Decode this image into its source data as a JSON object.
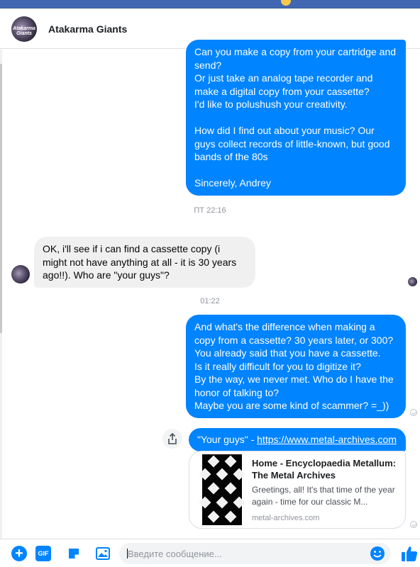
{
  "header": {
    "avatar_text": "Atakarma Giants",
    "title": "Atakarma Giants"
  },
  "messages": {
    "m1": {
      "line1": "Can you make a copy from your cartridge and send?",
      "line2": "Or just take an analog tape recorder and make a digital copy from your cassette?",
      "line3": "I'd like to polushush your creativity.",
      "line4": "How did I find out about your music? Our guys collect records of little-known, but good bands of the 80s",
      "line5": "Sincerely, Andrey"
    },
    "ts1": "ПТ 22:16",
    "incoming": "OK, i'll see if i can find a cassette copy (i might not have anything at all - it is 30 years ago!!). Who are \"your guys\"?",
    "ts2": "01:22",
    "m2": {
      "line1": "And what's the difference when making a copy from a cassette? 30 years later, or 300?",
      "line2": "You already said that you have a cassette.",
      "line3": "Is it really difficult for you to digitize it?",
      "line4": "By the way, we never met. Who do I have the honor of talking to?",
      "line5": "Maybe you are some kind of scammer? =_))"
    },
    "m3": {
      "prefix": "\"Your guys\" - ",
      "link": "https://www.metal-archives.com"
    },
    "link_card": {
      "title": "Home - Encyclopaedia Metallum: The Metal Archives",
      "description": "Greetings, all! It's that time of the year again - time for our classic M...",
      "domain": "metal-archives.com"
    }
  },
  "composer": {
    "placeholder": "Введите сообщение...",
    "gif_label": "GIF",
    "plus_label": "+"
  },
  "colors": {
    "accent": "#0084ff",
    "incoming_bg": "#f1f0f0",
    "header_bar": "#4267b2"
  },
  "icons": [
    "plus-icon",
    "gif-icon",
    "sticker-icon",
    "photo-icon",
    "emoji-icon",
    "thumbs-up-icon",
    "share-icon",
    "seen-check-icon"
  ]
}
